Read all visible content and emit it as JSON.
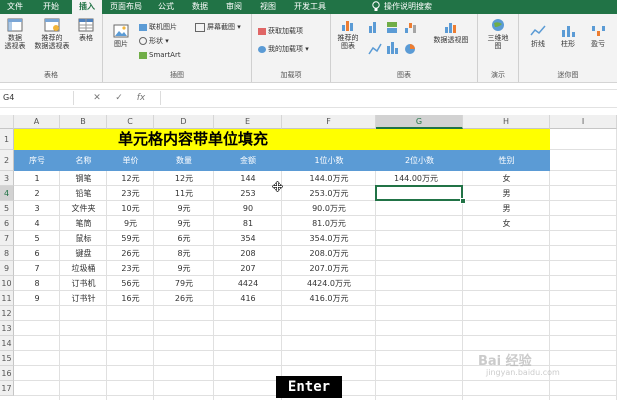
{
  "ribbon": {
    "tabs": [
      "文件",
      "开始",
      "插入",
      "页面布局",
      "公式",
      "数据",
      "审阅",
      "视图",
      "开发工具",
      "操作说明搜索"
    ],
    "active_tab": "插入",
    "groups": {
      "tables": {
        "label": "表格",
        "pivot_table": "数据\n透视表",
        "recommended_pivot": "推荐的\n数据透视表",
        "table": "表格"
      },
      "illustrations": {
        "label": "插图",
        "pictures": "图片",
        "online_pictures": "联机图片",
        "shapes": "形状",
        "smartart": "SmartArt",
        "screenshot": "屏幕截图"
      },
      "addins": {
        "label": "加载项",
        "get_addins": "获取加载项",
        "my_addins": "我的加载项"
      },
      "charts": {
        "label": "图表",
        "recommended_charts": "推荐的\n图表",
        "pivot_chart": "数据透视图"
      },
      "tours": {
        "label": "演示",
        "map3d": "三维地\n图"
      },
      "sparklines": {
        "label": "迷你图",
        "line": "折线",
        "column": "柱形",
        "winloss": "盈亏"
      }
    }
  },
  "formula_bar": {
    "name_box": "G4",
    "cancel_symbol": "✕",
    "enter_symbol": "✓",
    "fx_symbol": "fx",
    "value": ""
  },
  "sheet": {
    "columns": [
      "A",
      "B",
      "C",
      "D",
      "E",
      "F",
      "G",
      "H",
      "I"
    ],
    "selected_column": "G",
    "row_numbers": [
      "1",
      "2",
      "3",
      "4",
      "5",
      "6",
      "7",
      "8",
      "9",
      "10",
      "11",
      "12",
      "13",
      "14",
      "15",
      "16",
      "17"
    ],
    "selected_row": "4",
    "title": "单元格内容带单位填充",
    "headers": [
      "序号",
      "名称",
      "单价",
      "数量",
      "金额",
      "1位小数",
      "2位小数",
      "性别"
    ],
    "rows": [
      [
        "1",
        "钢笔",
        "12元",
        "12元",
        "144",
        "144.0万元",
        "144.00万元",
        "女"
      ],
      [
        "2",
        "铅笔",
        "23元",
        "11元",
        "253",
        "253.0万元",
        "",
        "男"
      ],
      [
        "3",
        "文件夹",
        "10元",
        "9元",
        "90",
        "90.0万元",
        "",
        "男"
      ],
      [
        "4",
        "笔筒",
        "9元",
        "9元",
        "81",
        "81.0万元",
        "",
        "女"
      ],
      [
        "5",
        "鼠标",
        "59元",
        "6元",
        "354",
        "354.0万元",
        "",
        ""
      ],
      [
        "6",
        "键盘",
        "26元",
        "8元",
        "208",
        "208.0万元",
        "",
        ""
      ],
      [
        "7",
        "垃圾桶",
        "23元",
        "9元",
        "207",
        "207.0万元",
        "",
        ""
      ],
      [
        "8",
        "订书机",
        "56元",
        "79元",
        "4424",
        "4424.0万元",
        "",
        ""
      ],
      [
        "9",
        "订书针",
        "16元",
        "26元",
        "416",
        "416.0万元",
        "",
        ""
      ]
    ]
  },
  "overlay": {
    "key_pressed": "Enter",
    "watermark": "Bai 经验",
    "watermark_sub": "jingyan.baidu.com"
  },
  "colors": {
    "excel_green": "#217346",
    "title_fill": "#ffff00",
    "header_fill": "#5b9bd5"
  }
}
